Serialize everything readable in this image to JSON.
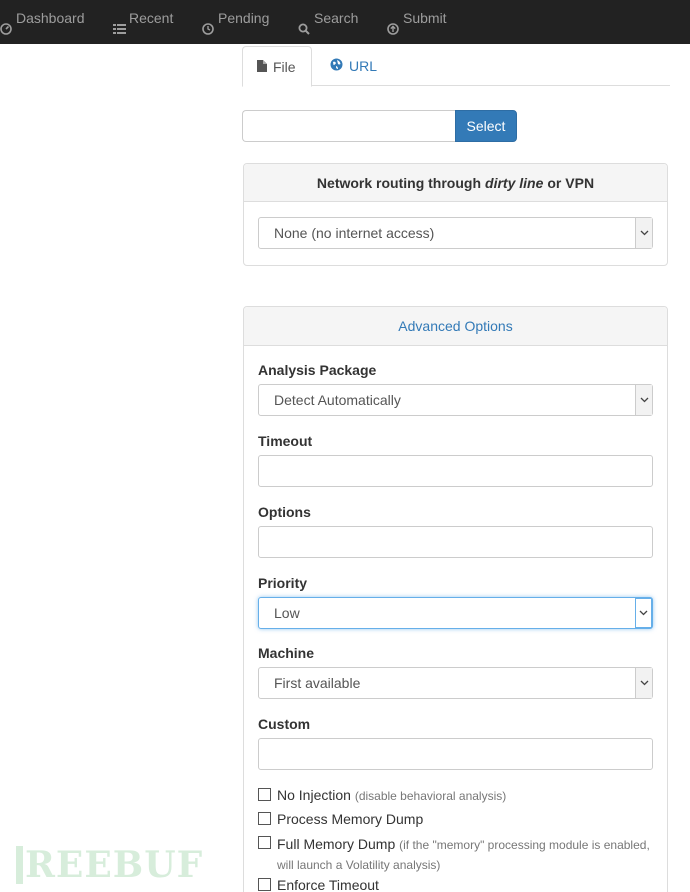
{
  "nav": {
    "items": [
      {
        "label": "Dashboard",
        "icon": "dashboard-icon"
      },
      {
        "label": "Recent",
        "icon": "list-icon"
      },
      {
        "label": "Pending",
        "icon": "clock-icon"
      },
      {
        "label": "Search",
        "icon": "search-icon"
      },
      {
        "label": "Submit",
        "icon": "upload-icon"
      }
    ]
  },
  "tabs": [
    {
      "label": "File",
      "icon": "file-icon",
      "active": true
    },
    {
      "label": "URL",
      "icon": "globe-icon",
      "active": false
    }
  ],
  "file_select": {
    "button_label": "Select",
    "value": ""
  },
  "routing": {
    "heading_prefix": "Network routing through ",
    "heading_emphasis": "dirty line",
    "heading_suffix": " or VPN",
    "selected": "None (no internet access)"
  },
  "advanced": {
    "heading": "Advanced Options",
    "package_label": "Analysis Package",
    "package_value": "Detect Automatically",
    "timeout_label": "Timeout",
    "timeout_value": "",
    "options_label": "Options",
    "options_value": "",
    "priority_label": "Priority",
    "priority_value": "Low",
    "machine_label": "Machine",
    "machine_value": "First available",
    "custom_label": "Custom",
    "custom_value": ""
  },
  "checks": [
    {
      "label": "No Injection",
      "note": "(disable behavioral analysis)"
    },
    {
      "label": "Process Memory Dump",
      "note": ""
    },
    {
      "label": "Full Memory Dump",
      "note": "(if the \"memory\" processing module is enabled,",
      "note2": "will launch a Volatility analysis)"
    },
    {
      "label": "Enforce Timeout",
      "note": ""
    }
  ],
  "watermark": "REEBUF",
  "colors": {
    "navbar": "#222222",
    "nav_text": "#9d9d9d",
    "primary": "#337ab7",
    "panel_heading_bg": "#f5f5f5",
    "focus_border": "#66afe9"
  }
}
